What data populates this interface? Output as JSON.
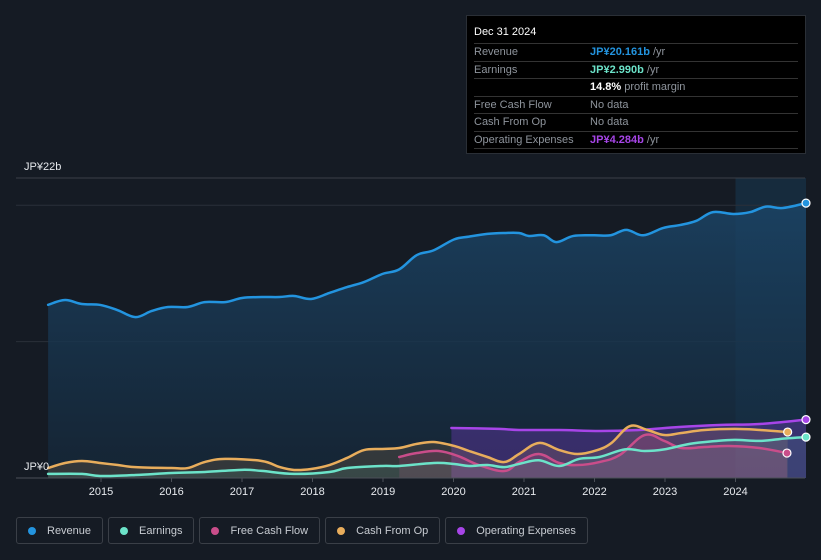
{
  "tooltip": {
    "date": "Dec 31 2024",
    "rows": [
      {
        "label": "Revenue",
        "value": "JP¥20.161b",
        "suffix": " /yr",
        "color": "#2394df"
      },
      {
        "label": "Earnings",
        "value": "JP¥2.990b",
        "suffix": " /yr",
        "color": "#6ce3c9"
      },
      {
        "label": "",
        "value": "14.8%",
        "suffix": " profit margin",
        "color": "#ffffff"
      },
      {
        "label": "Free Cash Flow",
        "value": "",
        "suffix": "No data",
        "color": "#8e949c"
      },
      {
        "label": "Cash From Op",
        "value": "",
        "suffix": "No data",
        "color": "#8e949c"
      },
      {
        "label": "Operating Expenses",
        "value": "JP¥4.284b",
        "suffix": " /yr",
        "color": "#a745e8"
      }
    ]
  },
  "legend": [
    {
      "label": "Revenue",
      "color": "#2394df"
    },
    {
      "label": "Earnings",
      "color": "#6ce3c9"
    },
    {
      "label": "Free Cash Flow",
      "color": "#c94d8a"
    },
    {
      "label": "Cash From Op",
      "color": "#e8ad5c"
    },
    {
      "label": "Operating Expenses",
      "color": "#a745e8"
    }
  ],
  "chart_data": {
    "type": "line",
    "title": "",
    "xlabel": "",
    "ylabel": "",
    "y_unit": "JP¥ billions",
    "ylim": [
      0,
      22
    ],
    "y_tick_labels": [
      "JP¥0",
      "JP¥22b"
    ],
    "x_tick_labels": [
      "2015",
      "2016",
      "2017",
      "2018",
      "2019",
      "2020",
      "2021",
      "2022",
      "2023",
      "2024"
    ],
    "xlim": [
      2014.25,
      2025.0
    ],
    "highlight_from": 2024.0,
    "grid": true,
    "legend_position": "bottom",
    "series": [
      {
        "name": "Revenue",
        "color": "#2394df",
        "area": true,
        "x": [
          2014.25,
          2014.49,
          2014.73,
          2014.99,
          2015.24,
          2015.49,
          2015.72,
          2015.95,
          2016.23,
          2016.47,
          2016.76,
          2017.0,
          2017.28,
          2017.53,
          2017.74,
          2017.98,
          2018.24,
          2018.49,
          2018.73,
          2018.99,
          2019.23,
          2019.48,
          2019.72,
          2020.01,
          2020.22,
          2020.48,
          2020.72,
          2020.93,
          2021.07,
          2021.28,
          2021.46,
          2021.7,
          2021.99,
          2022.23,
          2022.45,
          2022.69,
          2022.97,
          2023.21,
          2023.44,
          2023.68,
          2023.97,
          2024.21,
          2024.43,
          2024.67,
          2025.0
        ],
        "values": [
          12.7,
          13.05,
          12.76,
          12.69,
          12.3,
          11.8,
          12.25,
          12.54,
          12.54,
          12.9,
          12.9,
          13.2,
          13.27,
          13.27,
          13.35,
          13.13,
          13.57,
          14.0,
          14.37,
          14.96,
          15.3,
          16.35,
          16.7,
          17.5,
          17.7,
          17.9,
          17.97,
          17.97,
          17.75,
          17.8,
          17.3,
          17.75,
          17.8,
          17.8,
          18.2,
          17.8,
          18.33,
          18.55,
          18.85,
          19.5,
          19.36,
          19.5,
          19.9,
          19.8,
          20.16
        ]
      },
      {
        "name": "Earnings",
        "color": "#6ce3c9",
        "area": true,
        "x": [
          2014.25,
          2014.73,
          2014.99,
          2015.49,
          2016.0,
          2016.47,
          2017.0,
          2017.28,
          2017.74,
          2018.24,
          2018.49,
          2018.99,
          2019.23,
          2019.72,
          2020.01,
          2020.22,
          2020.48,
          2020.72,
          2020.93,
          2021.21,
          2021.5,
          2021.78,
          2022.07,
          2022.43,
          2022.71,
          2022.99,
          2023.35,
          2023.7,
          2023.99,
          2024.35,
          2024.7,
          2025.0
        ],
        "values": [
          0.3,
          0.3,
          0.15,
          0.22,
          0.37,
          0.44,
          0.6,
          0.52,
          0.3,
          0.44,
          0.73,
          0.88,
          0.88,
          1.1,
          1.03,
          0.88,
          0.95,
          0.8,
          1.03,
          1.3,
          0.88,
          1.4,
          1.54,
          2.1,
          1.98,
          2.1,
          2.5,
          2.7,
          2.8,
          2.72,
          2.9,
          3.0
        ]
      },
      {
        "name": "Free Cash Flow",
        "color": "#c94d8a",
        "area": true,
        "x": [
          2019.23,
          2019.48,
          2019.79,
          2020.07,
          2020.36,
          2020.72,
          2020.93,
          2021.21,
          2021.5,
          2021.76,
          2022.07,
          2022.36,
          2022.71,
          2022.99,
          2023.23,
          2023.56,
          2023.91,
          2024.34,
          2024.73
        ],
        "values": [
          1.54,
          1.83,
          1.98,
          1.6,
          0.95,
          0.51,
          1.17,
          1.76,
          1.1,
          0.95,
          1.17,
          1.69,
          3.15,
          2.72,
          2.2,
          2.27,
          2.35,
          2.2,
          1.83
        ]
      },
      {
        "name": "Cash From Op",
        "color": "#e8ad5c",
        "area": true,
        "x": [
          2014.25,
          2014.49,
          2014.73,
          2014.99,
          2015.24,
          2015.49,
          2016.0,
          2016.23,
          2016.47,
          2016.76,
          2017.28,
          2017.53,
          2017.74,
          2017.98,
          2018.24,
          2018.49,
          2018.73,
          2018.99,
          2019.23,
          2019.48,
          2019.72,
          2020.01,
          2020.22,
          2020.48,
          2020.72,
          2020.93,
          2021.21,
          2021.5,
          2021.76,
          2022.04,
          2022.24,
          2022.5,
          2022.75,
          2022.99,
          2023.23,
          2023.56,
          2023.99,
          2024.35,
          2024.74
        ],
        "values": [
          0.73,
          1.1,
          1.25,
          1.1,
          0.95,
          0.8,
          0.73,
          0.73,
          1.17,
          1.4,
          1.25,
          0.81,
          0.59,
          0.66,
          0.95,
          1.47,
          2.05,
          2.13,
          2.2,
          2.5,
          2.64,
          2.35,
          1.98,
          1.54,
          1.17,
          1.76,
          2.57,
          2.05,
          1.76,
          2.05,
          2.57,
          3.8,
          3.52,
          3.15,
          3.3,
          3.52,
          3.6,
          3.52,
          3.37
        ]
      },
      {
        "name": "Operating Expenses",
        "color": "#a745e8",
        "area": true,
        "x": [
          2019.97,
          2020.65,
          2020.93,
          2021.5,
          2022.07,
          2022.63,
          2023.2,
          2023.77,
          2024.34,
          2025.0
        ],
        "values": [
          3.67,
          3.6,
          3.52,
          3.52,
          3.45,
          3.52,
          3.74,
          3.89,
          3.96,
          4.28
        ]
      }
    ]
  }
}
